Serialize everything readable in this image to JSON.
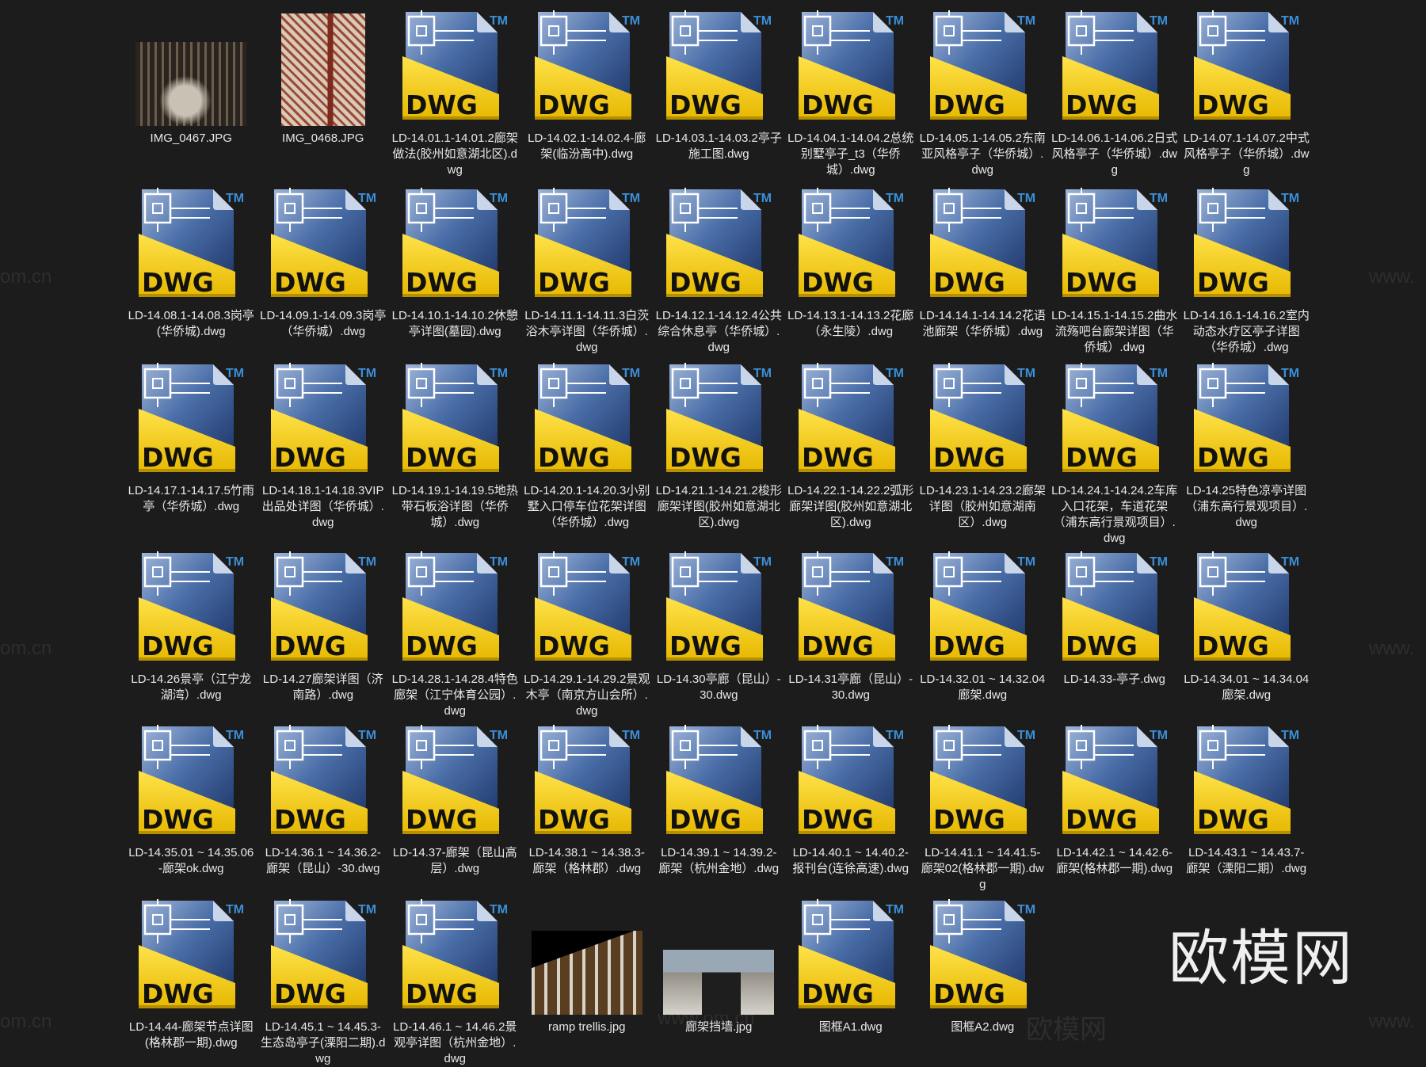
{
  "watermark": "欧模网",
  "faint_watermarks": [
    "om.cn",
    "www.",
    "欧模网",
    "www.om.cn"
  ],
  "icon_text": {
    "dwg": "DWG",
    "tm": "TM"
  },
  "colors": {
    "background": "#1c1c1c",
    "dwg_yellow": "#f2c500",
    "dwg_blue": "#2b4f8a",
    "tm_blue": "#3b8fd8"
  },
  "rows": [
    [
      {
        "name": "IMG_0467.JPG",
        "type": "image",
        "thumb": "p467"
      },
      {
        "name": "IMG_0468.JPG",
        "type": "image",
        "thumb": "p468"
      },
      {
        "name": "LD-14.01.1-14.01.2廊架做法(胶州如意湖北区).dwg",
        "type": "dwg"
      },
      {
        "name": "LD-14.02.1-14.02.4-廊架(临汾高中).dwg",
        "type": "dwg"
      },
      {
        "name": "LD-14.03.1-14.03.2亭子施工图.dwg",
        "type": "dwg"
      },
      {
        "name": "LD-14.04.1-14.04.2总统别墅亭子_t3（华侨城）.dwg",
        "type": "dwg"
      },
      {
        "name": "LD-14.05.1-14.05.2东南亚风格亭子（华侨城）.dwg",
        "type": "dwg"
      },
      {
        "name": "LD-14.06.1-14.06.2日式风格亭子（华侨城）.dwg",
        "type": "dwg"
      },
      {
        "name": "LD-14.07.1-14.07.2中式风格亭子（华侨城）.dwg",
        "type": "dwg"
      }
    ],
    [
      {
        "name": "LD-14.08.1-14.08.3岗亭(华侨城).dwg",
        "type": "dwg"
      },
      {
        "name": "LD-14.09.1-14.09.3岗亭（华侨城）.dwg",
        "type": "dwg"
      },
      {
        "name": "LD-14.10.1-14.10.2休憩亭详图(墓园).dwg",
        "type": "dwg"
      },
      {
        "name": "LD-14.11.1-14.11.3白茨浴木亭详图（华侨城）.dwg",
        "type": "dwg"
      },
      {
        "name": "LD-14.12.1-14.12.4公共综合休息亭（华侨城）.dwg",
        "type": "dwg"
      },
      {
        "name": "LD-14.13.1-14.13.2花廊（永生陵）.dwg",
        "type": "dwg"
      },
      {
        "name": "LD-14.14.1-14.14.2花语池廊架（华侨城）.dwg",
        "type": "dwg"
      },
      {
        "name": "LD-14.15.1-14.15.2曲水流殇吧台廊架详图（华侨城）.dwg",
        "type": "dwg"
      },
      {
        "name": "LD-14.16.1-14.16.2室内动态水疗区亭子详图（华侨城）.dwg",
        "type": "dwg"
      }
    ],
    [
      {
        "name": "LD-14.17.1-14.17.5竹雨亭（华侨城）.dwg",
        "type": "dwg"
      },
      {
        "name": "LD-14.18.1-14.18.3VIP出品处详图（华侨城）.dwg",
        "type": "dwg"
      },
      {
        "name": "LD-14.19.1-14.19.5地热带石板浴详图（华侨城）.dwg",
        "type": "dwg"
      },
      {
        "name": "LD-14.20.1-14.20.3小别墅入口停车位花架详图（华侨城）.dwg",
        "type": "dwg"
      },
      {
        "name": "LD-14.21.1-14.21.2梭形廊架详图(胶州如意湖北区).dwg",
        "type": "dwg"
      },
      {
        "name": "LD-14.22.1-14.22.2弧形廊架详图(胶州如意湖北区).dwg",
        "type": "dwg"
      },
      {
        "name": "LD-14.23.1-14.23.2廊架详图（胶州如意湖南区）.dwg",
        "type": "dwg"
      },
      {
        "name": "LD-14.24.1-14.24.2车库入口花架，车道花架（浦东高行景观项目）.dwg",
        "type": "dwg"
      },
      {
        "name": "LD-14.25特色凉亭详图（浦东高行景观项目）.dwg",
        "type": "dwg"
      }
    ],
    [
      {
        "name": "LD-14.26景亭（江宁龙湖湾）.dwg",
        "type": "dwg"
      },
      {
        "name": "LD-14.27廊架详图（济南路）.dwg",
        "type": "dwg"
      },
      {
        "name": "LD-14.28.1-14.28.4特色廊架（江宁体育公园）.dwg",
        "type": "dwg"
      },
      {
        "name": "LD-14.29.1-14.29.2景观木亭（南京方山会所）.dwg",
        "type": "dwg"
      },
      {
        "name": "LD-14.30亭廊（昆山）-30.dwg",
        "type": "dwg"
      },
      {
        "name": "LD-14.31亭廊（昆山）-30.dwg",
        "type": "dwg"
      },
      {
        "name": "LD-14.32.01 ~ 14.32.04廊架.dwg",
        "type": "dwg"
      },
      {
        "name": "LD-14.33-亭子.dwg",
        "type": "dwg"
      },
      {
        "name": "LD-14.34.01 ~ 14.34.04廊架.dwg",
        "type": "dwg"
      }
    ],
    [
      {
        "name": "LD-14.35.01 ~ 14.35.06-廊架ok.dwg",
        "type": "dwg"
      },
      {
        "name": "LD-14.36.1 ~ 14.36.2-廊架（昆山）-30.dwg",
        "type": "dwg"
      },
      {
        "name": "LD-14.37-廊架（昆山高层）.dwg",
        "type": "dwg"
      },
      {
        "name": "LD-14.38.1 ~ 14.38.3-廊架（格林郡）.dwg",
        "type": "dwg"
      },
      {
        "name": "LD-14.39.1 ~ 14.39.2-廊架（杭州金地）.dwg",
        "type": "dwg"
      },
      {
        "name": "LD-14.40.1 ~ 14.40.2-报刊台(连徐高速).dwg",
        "type": "dwg"
      },
      {
        "name": "LD-14.41.1 ~ 14.41.5-廊架02(格林郡一期).dwg",
        "type": "dwg"
      },
      {
        "name": "LD-14.42.1 ~ 14.42.6-廊架(格林郡一期).dwg",
        "type": "dwg"
      },
      {
        "name": "LD-14.43.1 ~ 14.43.7-廊架（溧阳二期）.dwg",
        "type": "dwg"
      }
    ],
    [
      {
        "name": "LD-14.44-廊架节点详图(格林郡一期).dwg",
        "type": "dwg"
      },
      {
        "name": "LD-14.45.1 ~ 14.45.3-生态岛亭子(溧阳二期).dwg",
        "type": "dwg"
      },
      {
        "name": "LD-14.46.1 ~ 14.46.2景观亭详图（杭州金地）.dwg",
        "type": "dwg"
      },
      {
        "name": "ramp trellis.jpg",
        "type": "image",
        "thumb": "pramp"
      },
      {
        "name": "廊架挡墙.jpg",
        "type": "image",
        "thumb": "pwall"
      },
      {
        "name": "图框A1.dwg",
        "type": "dwg"
      },
      {
        "name": "图框A2.dwg",
        "type": "dwg"
      }
    ]
  ]
}
